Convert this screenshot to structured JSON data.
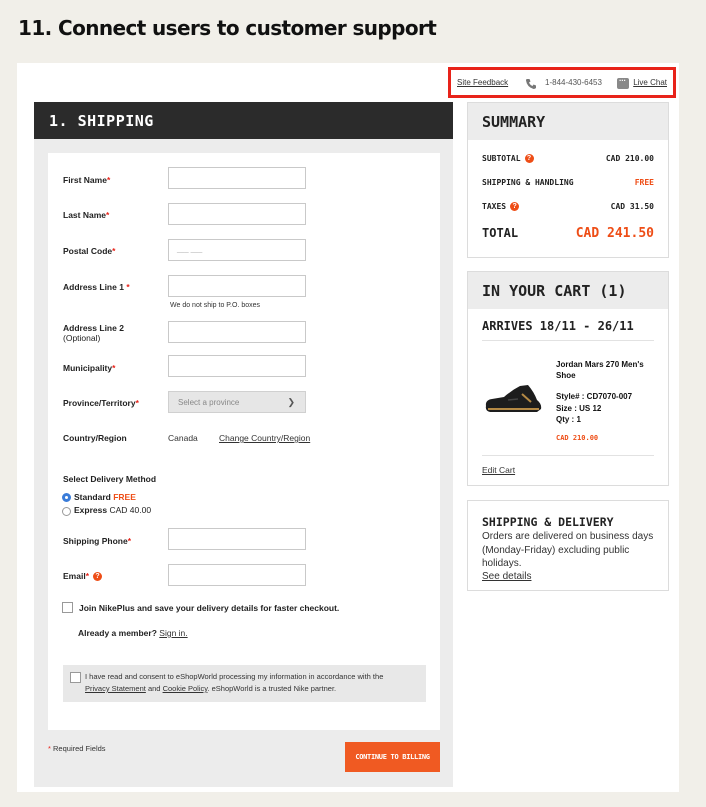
{
  "heading": "11. Connect users to customer support",
  "util": {
    "feedback": "Site Feedback",
    "phone": "1-844-430-6453",
    "chat": "Live Chat"
  },
  "shipping": {
    "title": "1. SHIPPING",
    "fields": {
      "first_name": "First Name",
      "last_name": "Last Name",
      "postal": "Postal Code",
      "postal_placeholder": "___ ___",
      "address1": "Address Line 1 ",
      "address_note": "We do not ship to P.O. boxes",
      "address2": "Address Line 2",
      "address2_sub": "(Optional)",
      "municipality": "Municipality",
      "province": "Province/Territory",
      "province_placeholder": "Select a province",
      "country": "Country/Region",
      "country_value": "Canada",
      "change_country": "Change Country/Region",
      "phone": "Shipping Phone",
      "email": "Email"
    },
    "delivery": {
      "title": "Select Delivery Method",
      "standard": "Standard",
      "standard_price": "FREE",
      "express": "Express",
      "express_price": "CAD 40.00"
    },
    "join": "Join NikePlus and save your delivery details for faster checkout.",
    "member": "Already a member?",
    "sign_in": "Sign in.",
    "consent_1": "I have read and consent to eShopWorld processing my information in accordance with the",
    "privacy": "Privacy Statement",
    "and": "and",
    "cookie": "Cookie Policy",
    "consent_2": ". eShopWorld is a trusted Nike partner.",
    "required": "Required Fields",
    "cta": "CONTINUE TO BILLING"
  },
  "summary": {
    "title": "SUMMARY",
    "subtotal_label": "SUBTOTAL",
    "subtotal": "CAD 210.00",
    "shipping_label": "SHIPPING & HANDLING",
    "shipping": "FREE",
    "taxes_label": "TAXES",
    "taxes": "CAD 31.50",
    "total_label": "TOTAL",
    "total": "CAD 241.50"
  },
  "cart": {
    "title": "IN YOUR CART (1)",
    "arrives": "ARRIVES 18/11 - 26/11",
    "product": "Jordan Mars 270 Men's Shoe",
    "style": "Style# :  CD7070-007",
    "size": "Size : US 12",
    "qty": "Qty : 1",
    "price": "CAD 210.00",
    "edit": "Edit Cart"
  },
  "delivery_info": {
    "title": "SHIPPING & DELIVERY",
    "text": "Orders are delivered on business days (Monday-Friday) excluding public holidays.",
    "link": "See details"
  },
  "colors": {
    "accent": "#f05a22",
    "highlight": "#e8231a",
    "dark": "#2b2b2b"
  },
  "icons": [
    "phone-icon",
    "chat-icon",
    "info-icon",
    "chevron-down-icon",
    "shoe-image"
  ]
}
